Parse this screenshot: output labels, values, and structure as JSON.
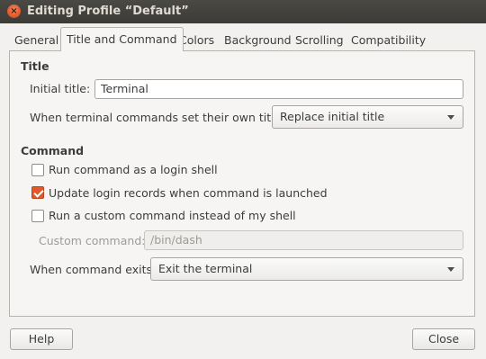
{
  "window": {
    "title": "Editing Profile “Default”",
    "close_glyph": "×"
  },
  "tabs": [
    {
      "label": "General",
      "active": false
    },
    {
      "label": "Title and Command",
      "active": true
    },
    {
      "label": "Colors",
      "active": false
    },
    {
      "label": "Background",
      "active": false
    },
    {
      "label": "Scrolling",
      "active": false
    },
    {
      "label": "Compatibility",
      "active": false
    }
  ],
  "title_section": {
    "heading": "Title",
    "initial_title_label": "Initial title:",
    "initial_title_value": "Terminal",
    "dynamic_title_label": "When terminal commands set their own titles:",
    "dynamic_title_value": "Replace initial title"
  },
  "command_section": {
    "heading": "Command",
    "login_shell": {
      "label": "Run command as a login shell",
      "checked": false
    },
    "update_records": {
      "label": "Update login records when command is launched",
      "checked": true
    },
    "custom_command": {
      "label": "Run a custom command instead of my shell",
      "checked": false
    },
    "custom_command_label": "Custom command:",
    "custom_command_value": "/bin/dash",
    "exit_label": "When command exits:",
    "exit_value": "Exit the terminal"
  },
  "footer": {
    "help_label": "Help",
    "close_label": "Close"
  },
  "colors": {
    "titlebar": "#3c3b37",
    "accent_checkbox": "#e1582b",
    "close_button": "#e0572a"
  }
}
